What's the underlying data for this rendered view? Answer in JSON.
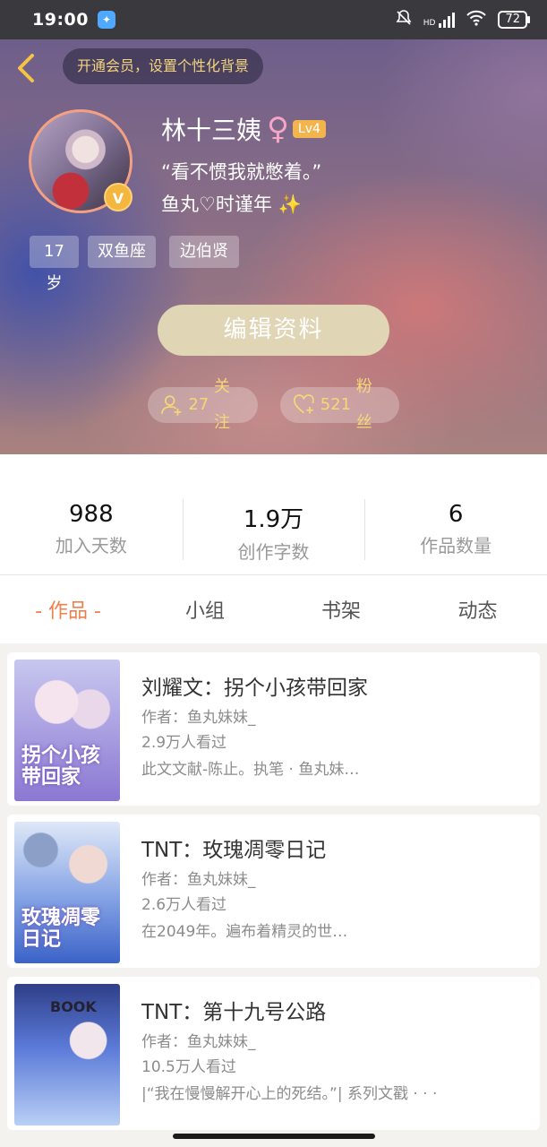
{
  "status_bar": {
    "time": "19:00",
    "hd": "HD",
    "battery": "72"
  },
  "header": {
    "vip_banner": "开通会员，设置个性化背景",
    "profile": {
      "name": "林十三姨",
      "gender_symbol": "♀",
      "level": "Lv4",
      "verified_badge": "V",
      "signature_line1": "“看不惯我就憋着。”",
      "signature_line2": "鱼丸♡时谨年",
      "sparkle": "✨"
    },
    "tags": [
      "17岁",
      "双鱼座",
      "边伯贤"
    ],
    "edit_button": "编辑资料",
    "follow": {
      "count": "27",
      "label": "关注"
    },
    "fans": {
      "count": "521",
      "label": "粉丝"
    }
  },
  "stats": [
    {
      "value": "988",
      "label": "加入天数"
    },
    {
      "value": "1.9万",
      "label": "创作字数"
    },
    {
      "value": "6",
      "label": "作品数量"
    }
  ],
  "tabs": [
    {
      "label": "- 作品 -",
      "active": true
    },
    {
      "label": "小组",
      "active": false
    },
    {
      "label": "书架",
      "active": false
    },
    {
      "label": "动态",
      "active": false
    }
  ],
  "colors": {
    "accent": "#ef7f4b",
    "vip_gold": "#f3d47d",
    "edit_button": "#e0d5b5"
  },
  "works": [
    {
      "title": "刘耀文：拐个小孩带回家",
      "author": "作者：鱼丸妹妹_",
      "views": "2.9万人看过",
      "desc": "此文文献-陈止。执笔 · 鱼丸妹…",
      "cover_text": "拐个小孩带回家"
    },
    {
      "title": "TNT：玫瑰凋零日记",
      "author": "作者：鱼丸妹妹_",
      "views": "2.6万人看过",
      "desc": "在2049年。遍布着精灵的世…",
      "cover_text": "玫瑰凋零日记"
    },
    {
      "title": "TNT：第十九号公路",
      "author": "作者：鱼丸妹妹_",
      "views": "10.5万人看过",
      "desc": "|“我在慢慢解开心上的死结。”| 系列文戳 · · ·",
      "cover_text": "BOOK"
    }
  ]
}
